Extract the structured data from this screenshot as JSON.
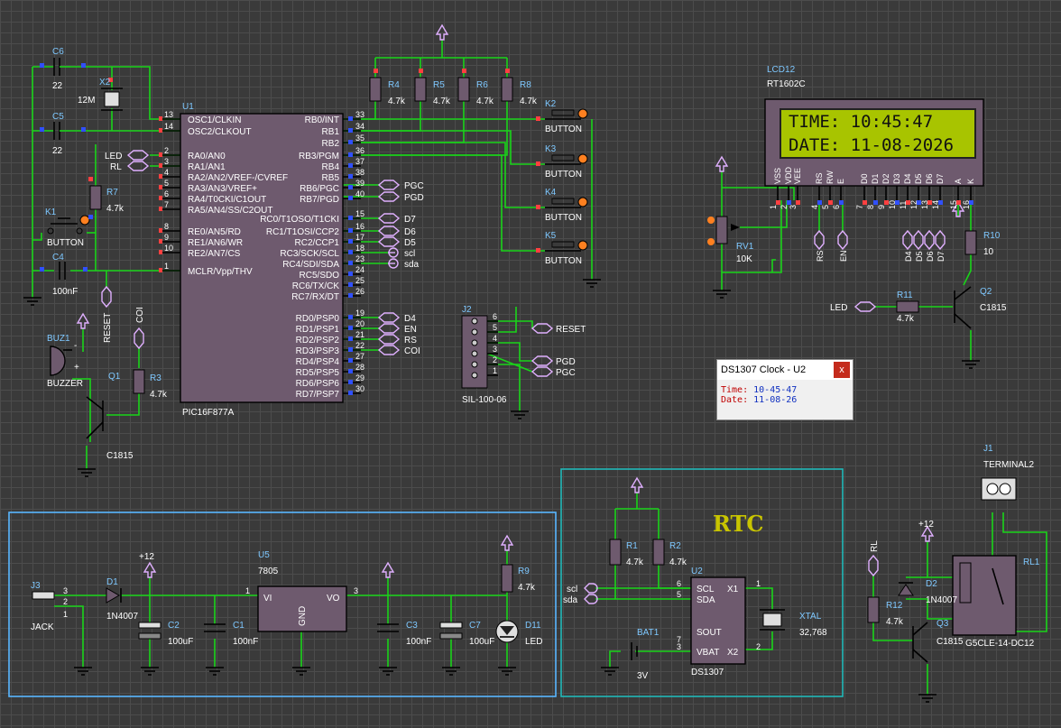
{
  "popup": {
    "title": "DS1307 Clock - U2",
    "close": "x",
    "time_label": "Time:",
    "time_value": "10-45-47",
    "date_label": "Date:",
    "date_value": "11-08-26"
  },
  "lcd": {
    "ref": "LCD12",
    "part": "RT1602C",
    "line1": "TIME: 10:45:47",
    "line2": "DATE: 11-08-2026",
    "pins": [
      "VSS",
      "VDD",
      "VEE",
      "RS",
      "RW",
      "E",
      "D0",
      "D1",
      "D2",
      "D3",
      "D4",
      "D5",
      "D6",
      "D7",
      "A",
      "K"
    ],
    "pin_nums": [
      "1",
      "2",
      "3",
      "4",
      "5",
      "6",
      "7",
      "8",
      "9",
      "10",
      "11",
      "12",
      "13",
      "14",
      "15",
      "16"
    ],
    "bottom_labels": [
      "RS",
      "EN",
      "D4",
      "D5",
      "D6",
      "D7"
    ]
  },
  "rtc_title": "RTC",
  "mcu": {
    "ref": "U1",
    "part": "PIC16F877A",
    "left_pins": [
      {
        "num": "13",
        "name": "OSC1/CLKIN"
      },
      {
        "num": "14",
        "name": "OSC2/CLKOUT"
      },
      {
        "num": "2",
        "name": "RA0/AN0"
      },
      {
        "num": "3",
        "name": "RA1/AN1"
      },
      {
        "num": "4",
        "name": "RA2/AN2/VREF-/CVREF"
      },
      {
        "num": "5",
        "name": "RA3/AN3/VREF+"
      },
      {
        "num": "6",
        "name": "RA4/T0CKI/C1OUT"
      },
      {
        "num": "7",
        "name": "RA5/AN4/SS/C2OUT"
      },
      {
        "num": "8",
        "name": "RE0/AN5/RD"
      },
      {
        "num": "9",
        "name": "RE1/AN6/WR"
      },
      {
        "num": "10",
        "name": "RE2/AN7/CS"
      },
      {
        "num": "1",
        "name": "MCLR/Vpp/THV"
      }
    ],
    "right_pins": [
      {
        "num": "33",
        "name": "RB0/INT"
      },
      {
        "num": "34",
        "name": "RB1"
      },
      {
        "num": "35",
        "name": "RB2"
      },
      {
        "num": "36",
        "name": "RB3/PGM"
      },
      {
        "num": "37",
        "name": "RB4"
      },
      {
        "num": "38",
        "name": "RB5"
      },
      {
        "num": "39",
        "name": "RB6/PGC"
      },
      {
        "num": "40",
        "name": "RB7/PGD"
      },
      {
        "num": "15",
        "name": "RC0/T1OSO/T1CKI"
      },
      {
        "num": "16",
        "name": "RC1/T1OSI/CCP2"
      },
      {
        "num": "17",
        "name": "RC2/CCP1"
      },
      {
        "num": "18",
        "name": "RC3/SCK/SCL"
      },
      {
        "num": "23",
        "name": "RC4/SDI/SDA"
      },
      {
        "num": "24",
        "name": "RC5/SDO"
      },
      {
        "num": "25",
        "name": "RC6/TX/CK"
      },
      {
        "num": "26",
        "name": "RC7/RX/DT"
      },
      {
        "num": "19",
        "name": "RD0/PSP0"
      },
      {
        "num": "20",
        "name": "RD1/PSP1"
      },
      {
        "num": "21",
        "name": "RD2/PSP2"
      },
      {
        "num": "22",
        "name": "RD3/PSP3"
      },
      {
        "num": "27",
        "name": "RD4/PSP4"
      },
      {
        "num": "28",
        "name": "RD5/PSP5"
      },
      {
        "num": "29",
        "name": "RD6/PSP6"
      },
      {
        "num": "30",
        "name": "RD7/PSP7"
      }
    ]
  },
  "net_labels": {
    "led": "LED",
    "rl": "RL",
    "pgc": "PGC",
    "pgd": "PGD",
    "d7": "D7",
    "d6": "D6",
    "d5": "D5",
    "scl": "scl",
    "sda": "sda",
    "d4": "D4",
    "en": "EN",
    "rs": "RS",
    "coi": "COI",
    "reset": "RESET",
    "plus12": "+12"
  },
  "components": {
    "c6": "C6",
    "c6v": "22",
    "c5": "C5",
    "c5v": "22",
    "x2": "X2",
    "x2v": "12M",
    "c4": "C4",
    "c4v": "100nF",
    "k1": "K1",
    "k1v": "BUTTON",
    "r7": "R7",
    "r7v": "4.7k",
    "r4": "R4",
    "r5": "R5",
    "r6": "R6",
    "r8": "R8",
    "rv": "4.7k",
    "k2": "K2",
    "k3": "K3",
    "k4": "K4",
    "k5": "K5",
    "btn": "BUTTON",
    "buz": "BUZ1",
    "buzv": "BUZZER",
    "q1": "Q1",
    "q1v": "C1815",
    "r3": "R3",
    "r3v": "4.7k",
    "j2": "J2",
    "j2v": "SIL-100-06",
    "rv1": "RV1",
    "rv1v": "10K",
    "r10": "R10",
    "r10v": "10",
    "r11": "R11",
    "r11v": "4.7k",
    "q2": "Q2",
    "q2v": "C1815",
    "j3": "J3",
    "j3v": "JACK",
    "d1": "D1",
    "d1v": "1N4007",
    "c2": "C2",
    "c2v": "100uF",
    "c1": "C1",
    "c1v": "100nF",
    "u5": "U5",
    "u5v": "7805",
    "vi": "VI",
    "vo": "VO",
    "gnd": "GND",
    "c3": "C3",
    "c3v": "100nF",
    "c7": "C7",
    "c7v": "100uF",
    "r9": "R9",
    "r9v": "4.7k",
    "d11": "D11",
    "d11v": "LED",
    "r1": "R1",
    "r1v": "4.7k",
    "r2": "R2",
    "r2v": "4.7k",
    "u2": "U2",
    "u2v": "DS1307",
    "scl": "SCL",
    "sda": "SDA",
    "x1": "X1",
    "x2p": "X2",
    "sout": "SOUT",
    "vbat": "VBAT",
    "bat": "BAT1",
    "batv": "3V",
    "xtal": "XTAL",
    "xtalv": "32,768",
    "j1": "J1",
    "j1v": "TERMINAL2",
    "rl1": "RL1",
    "rl1v": "G5CLE-14-DC12",
    "d2": "D2",
    "d2v": "1N4007",
    "r12": "R12",
    "r12v": "4.7k",
    "q3": "Q3",
    "q3v": "C1815",
    "rl": "RL"
  }
}
